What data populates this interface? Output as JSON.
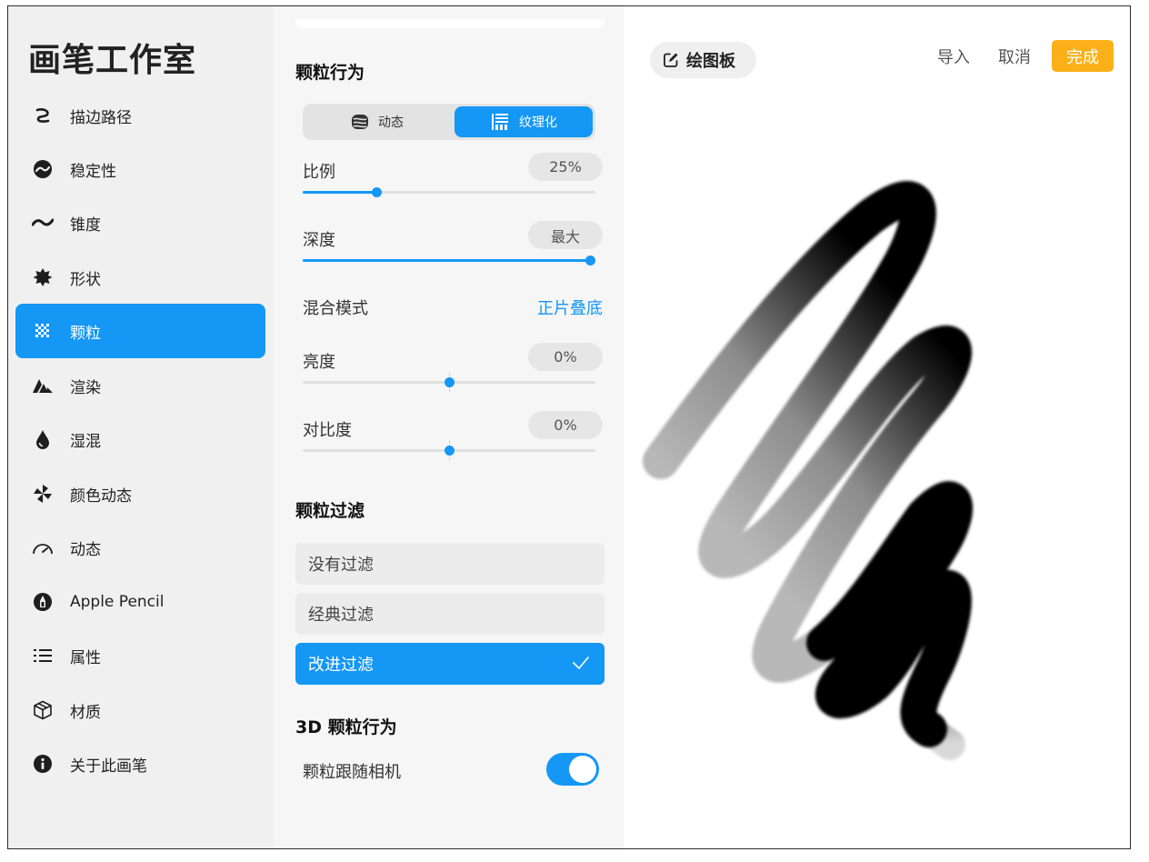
{
  "sidebar": {
    "title": "画笔工作室",
    "items": [
      {
        "label": "描边路径",
        "icon": "stroke-path-icon"
      },
      {
        "label": "稳定性",
        "icon": "stabilization-icon"
      },
      {
        "label": "锥度",
        "icon": "taper-icon"
      },
      {
        "label": "形状",
        "icon": "shape-icon"
      },
      {
        "label": "颗粒",
        "icon": "grain-icon",
        "active": true
      },
      {
        "label": "渲染",
        "icon": "rendering-icon"
      },
      {
        "label": "湿混",
        "icon": "wet-mix-icon"
      },
      {
        "label": "颜色动态",
        "icon": "color-dynamics-icon"
      },
      {
        "label": "动态",
        "icon": "dynamics-icon"
      },
      {
        "label": "Apple Pencil",
        "icon": "apple-pencil-icon"
      },
      {
        "label": "属性",
        "icon": "properties-icon"
      },
      {
        "label": "材质",
        "icon": "materials-icon"
      },
      {
        "label": "关于此画笔",
        "icon": "info-icon"
      }
    ]
  },
  "panel": {
    "grain_behavior_title": "颗粒行为",
    "segment": {
      "left": "动态",
      "right": "纹理化",
      "selected": "纹理化"
    },
    "scale": {
      "label": "比例",
      "value": "25%",
      "level": 0.25
    },
    "depth": {
      "label": "深度",
      "value": "最大",
      "level": 1.0
    },
    "blend": {
      "label": "混合模式",
      "value": "正片叠底"
    },
    "brightness": {
      "label": "亮度",
      "value": "0%",
      "level": 0.5
    },
    "contrast": {
      "label": "对比度",
      "value": "0%",
      "level": 0.5
    },
    "grain_filter_title": "颗粒过滤",
    "filters": [
      {
        "label": "没有过滤",
        "selected": false
      },
      {
        "label": "经典过滤",
        "selected": false
      },
      {
        "label": "改进过滤",
        "selected": true
      }
    ],
    "grain3d_title": "3D 颗粒行为",
    "follow_camera": {
      "label": "颗粒跟随相机",
      "on": true
    }
  },
  "canvas": {
    "pad_label": "绘图板",
    "import_label": "导入",
    "cancel_label": "取消",
    "done_label": "完成"
  },
  "colors": {
    "accent": "#1497f5",
    "done": "#fbb017",
    "sidebar_bg": "#f0f0f0",
    "panel_bg": "#f6f6f6"
  }
}
